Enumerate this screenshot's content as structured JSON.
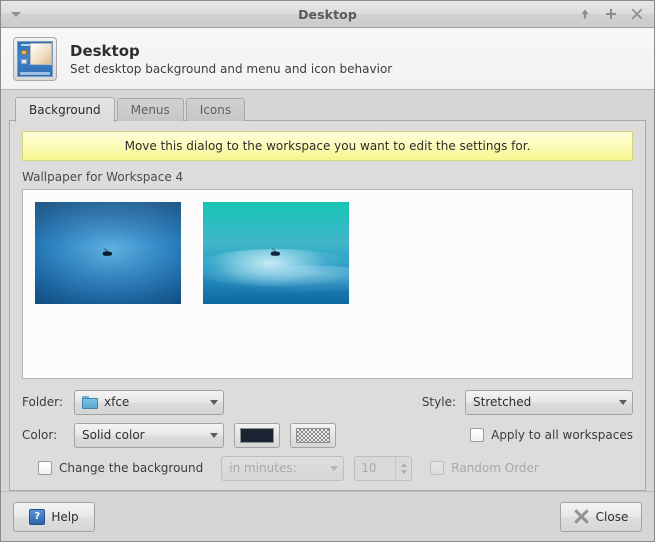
{
  "window": {
    "title": "Desktop",
    "menu_icon": "chevron-down-icon",
    "buttons": [
      {
        "name": "shade-button",
        "icon": "arrow-up-icon"
      },
      {
        "name": "maximize-button",
        "icon": "plus-icon"
      },
      {
        "name": "close-button",
        "icon": "x-icon"
      }
    ]
  },
  "header": {
    "icon": "desktop-preview-icon",
    "title": "Desktop",
    "subtitle": "Set desktop background and menu and icon behavior"
  },
  "tabs": [
    {
      "label": "Background",
      "active": true
    },
    {
      "label": "Menus",
      "active": false
    },
    {
      "label": "Icons",
      "active": false
    }
  ],
  "background_tab": {
    "notice": "Move this dialog to the workspace you want to edit the settings for.",
    "wallpaper_label": "Wallpaper for Workspace 4",
    "wallpapers": [
      {
        "name": "wallpaper-xfce-blue",
        "style": "blue",
        "selected": false
      },
      {
        "name": "wallpaper-xfce-teal",
        "style": "teal",
        "selected": false
      }
    ],
    "folder": {
      "label": "Folder:",
      "value": "xfce",
      "icon": "folder-icon"
    },
    "style": {
      "label": "Style:",
      "value": "Stretched"
    },
    "color": {
      "label": "Color:",
      "value": "Solid color",
      "swatch1_color": "#1a2433",
      "swatch2_pattern": "checkerboard"
    },
    "apply_all": {
      "label": "Apply to all workspaces",
      "checked": false
    },
    "change_background": {
      "label": "Change the background",
      "checked": false
    },
    "interval_mode": {
      "value": "in minutes:",
      "disabled": true
    },
    "interval_value": {
      "value": "10",
      "disabled": true
    },
    "random_order": {
      "label": "Random Order",
      "checked": false,
      "disabled": true
    }
  },
  "actions": {
    "help_label": "Help",
    "help_glyph": "?",
    "close_label": "Close"
  }
}
